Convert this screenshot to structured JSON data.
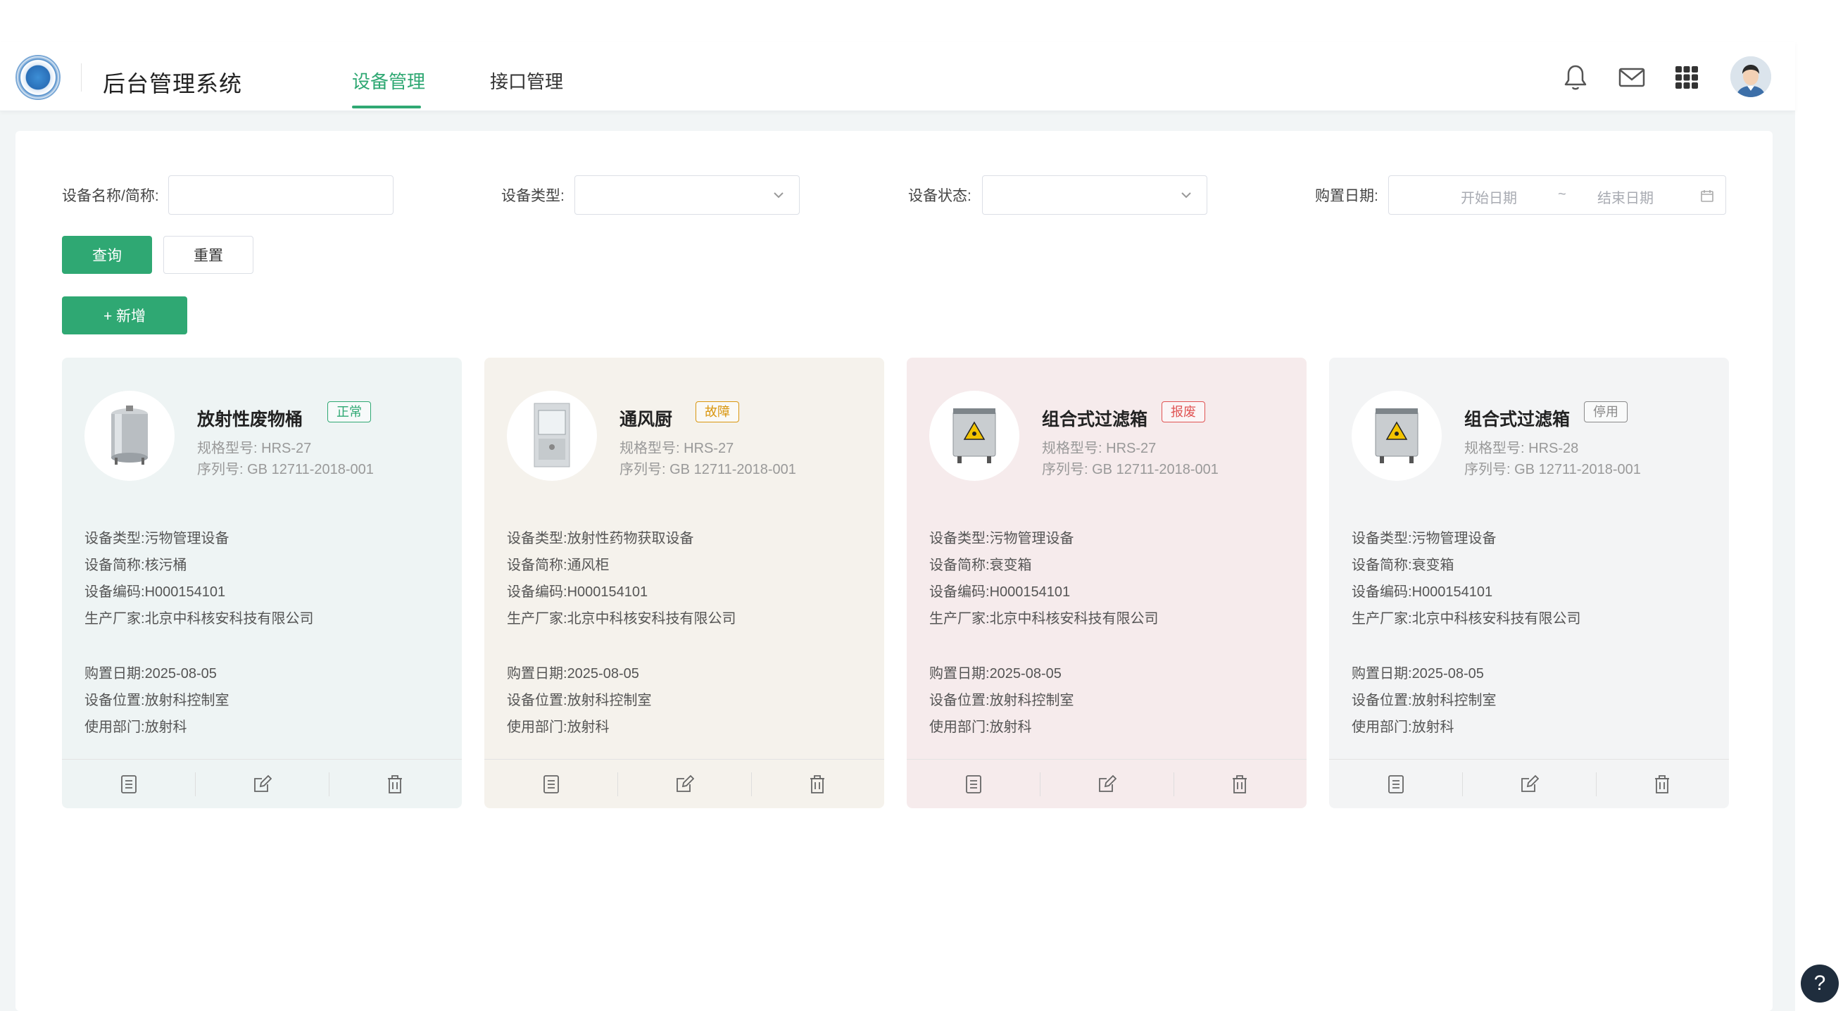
{
  "header": {
    "app_title": "后台管理系统",
    "tabs": [
      {
        "label": "设备管理",
        "active": true
      },
      {
        "label": "接口管理",
        "active": false
      }
    ],
    "icons": [
      "bell-icon",
      "mail-icon",
      "apps-grid-icon",
      "avatar"
    ]
  },
  "filters": {
    "name_label": "设备名称/简称:",
    "name_value": "",
    "type_label": "设备类型:",
    "type_value": "",
    "status_label": "设备状态:",
    "status_value": "",
    "date_label": "购置日期:",
    "start_placeholder": "开始日期",
    "range_sep": "~",
    "end_placeholder": "结束日期"
  },
  "buttons": {
    "query": "查询",
    "reset": "重置",
    "add": "+ 新增"
  },
  "field_labels": {
    "spec": "规格型号:",
    "serial": "序列号:",
    "type": "设备类型:",
    "short": "设备简称:",
    "code": "设备编码:",
    "maker": "生产厂家:",
    "date": "购置日期:",
    "location": "设备位置:",
    "dept": "使用部门:"
  },
  "cards": [
    {
      "name": "放射性废物桶",
      "status": "正常",
      "status_color": "#2fa873",
      "bg": "#eef4f4",
      "spec": "HRS-27",
      "serial": "GB 12711-2018-001",
      "type": "污物管理设备",
      "short": "核污桶",
      "code": "H000154101",
      "maker": "北京中科核安科技有限公司",
      "date": "2025-08-05",
      "location": "放射科控制室",
      "dept": "放射科"
    },
    {
      "name": "通风厨",
      "status": "故障",
      "status_color": "#d9960f",
      "bg": "#f5f2ec",
      "spec": "HRS-27",
      "serial": "GB 12711-2018-001",
      "type": "放射性药物获取设备",
      "short": "通风柜",
      "code": "H000154101",
      "maker": "北京中科核安科技有限公司",
      "date": "2025-08-05",
      "location": "放射科控制室",
      "dept": "放射科"
    },
    {
      "name": "组合式过滤箱",
      "status": "报废",
      "status_color": "#e05353",
      "bg": "#f6ebec",
      "spec": "HRS-27",
      "serial": "GB 12711-2018-001",
      "type": "污物管理设备",
      "short": "衰变箱",
      "code": "H000154101",
      "maker": "北京中科核安科技有限公司",
      "date": "2025-08-05",
      "location": "放射科控制室",
      "dept": "放射科"
    },
    {
      "name": "组合式过滤箱",
      "status": "停用",
      "status_color": "#8a8a8a",
      "bg": "#f3f4f5",
      "spec": "HRS-28",
      "serial": "GB 12711-2018-001",
      "type": "污物管理设备",
      "short": "衰变箱",
      "code": "H000154101",
      "maker": "北京中科核安科技有限公司",
      "date": "2025-08-05",
      "location": "放射科控制室",
      "dept": "放射科"
    }
  ],
  "help_glyph": "?"
}
